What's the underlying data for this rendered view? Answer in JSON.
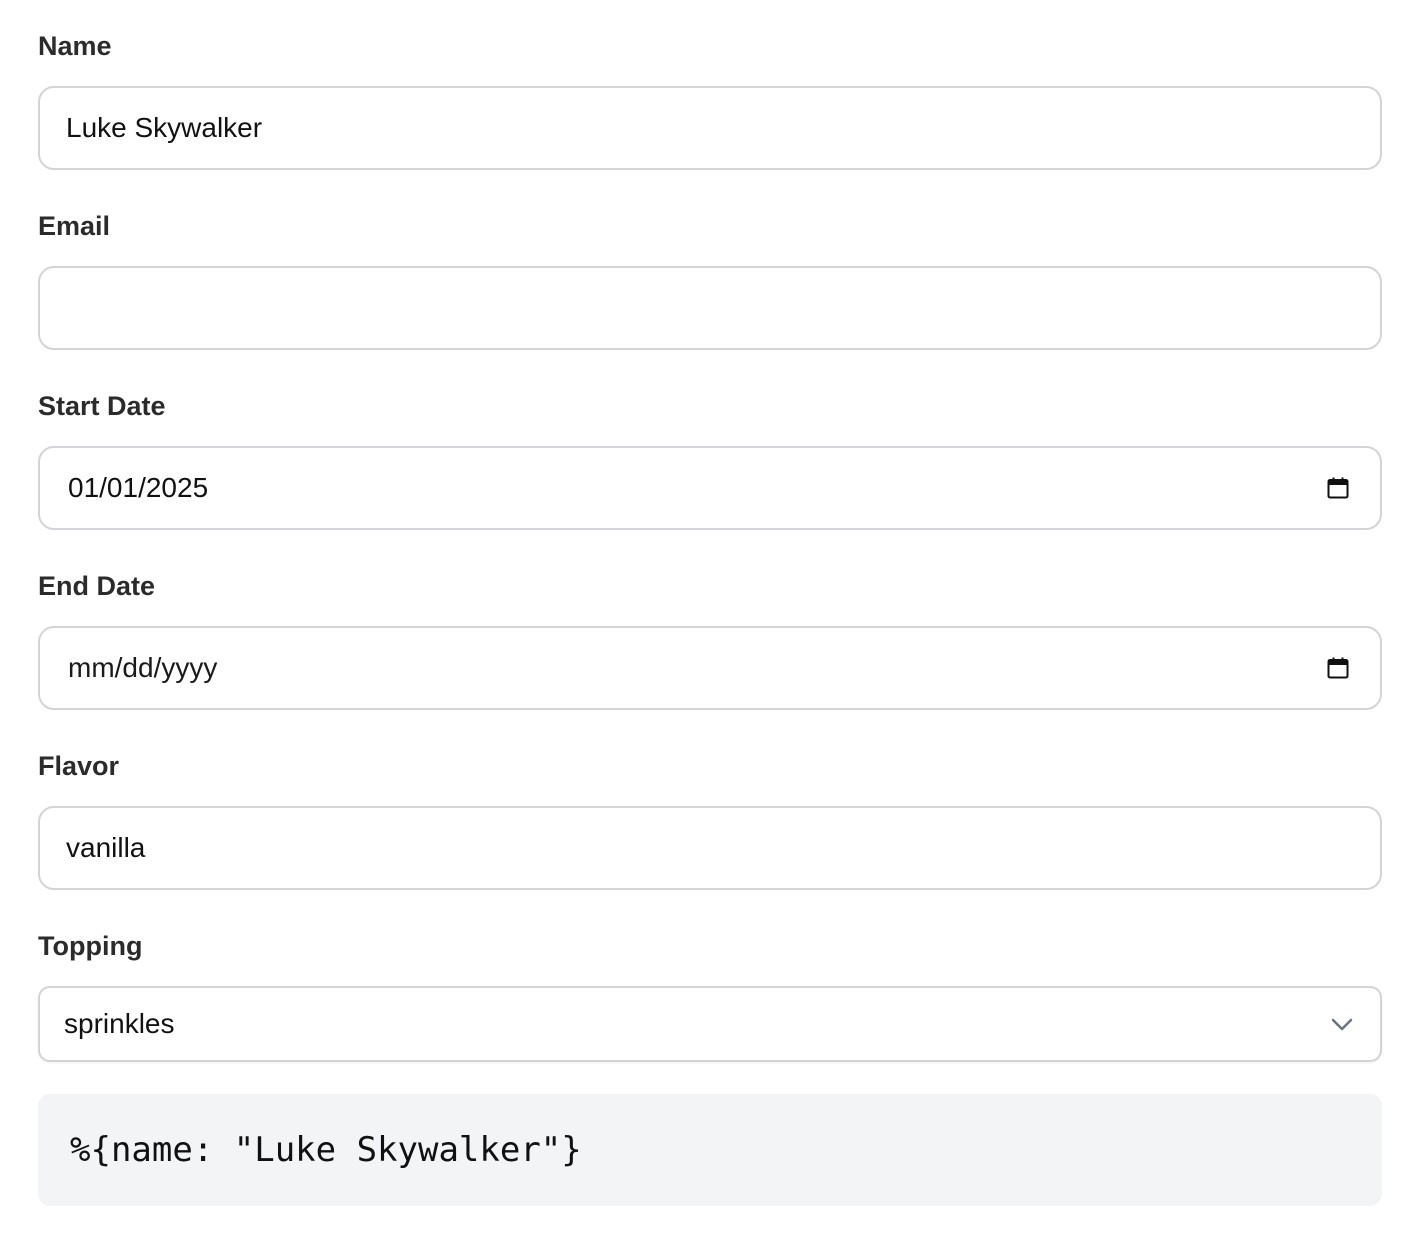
{
  "fields": {
    "name": {
      "label": "Name",
      "value": "Luke Skywalker"
    },
    "email": {
      "label": "Email",
      "value": ""
    },
    "start_date": {
      "label": "Start Date",
      "value": "01/01/2025",
      "icon": "calendar-icon"
    },
    "end_date": {
      "label": "End Date",
      "placeholder": "mm/dd/yyyy",
      "icon": "calendar-icon"
    },
    "flavor": {
      "label": "Flavor",
      "value": "vanilla"
    },
    "topping": {
      "label": "Topping",
      "selected": "sprinkles",
      "icon": "chevron-down-icon"
    }
  },
  "output": {
    "code": "%{name: \"Luke Skywalker\"}"
  },
  "colors": {
    "border": "#d4d4d8",
    "code_background": "#f3f4f6",
    "label_text": "#2b2b2b"
  }
}
